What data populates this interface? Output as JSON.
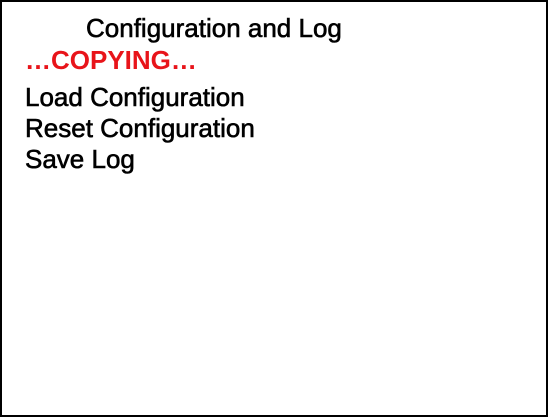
{
  "screen": {
    "title": "Configuration and Log",
    "status": "…COPYING…",
    "status_color": "#e8141a",
    "menu": {
      "items": [
        {
          "label": "Load Configuration"
        },
        {
          "label": "Reset Configuration"
        },
        {
          "label": "Save Log"
        }
      ]
    }
  }
}
